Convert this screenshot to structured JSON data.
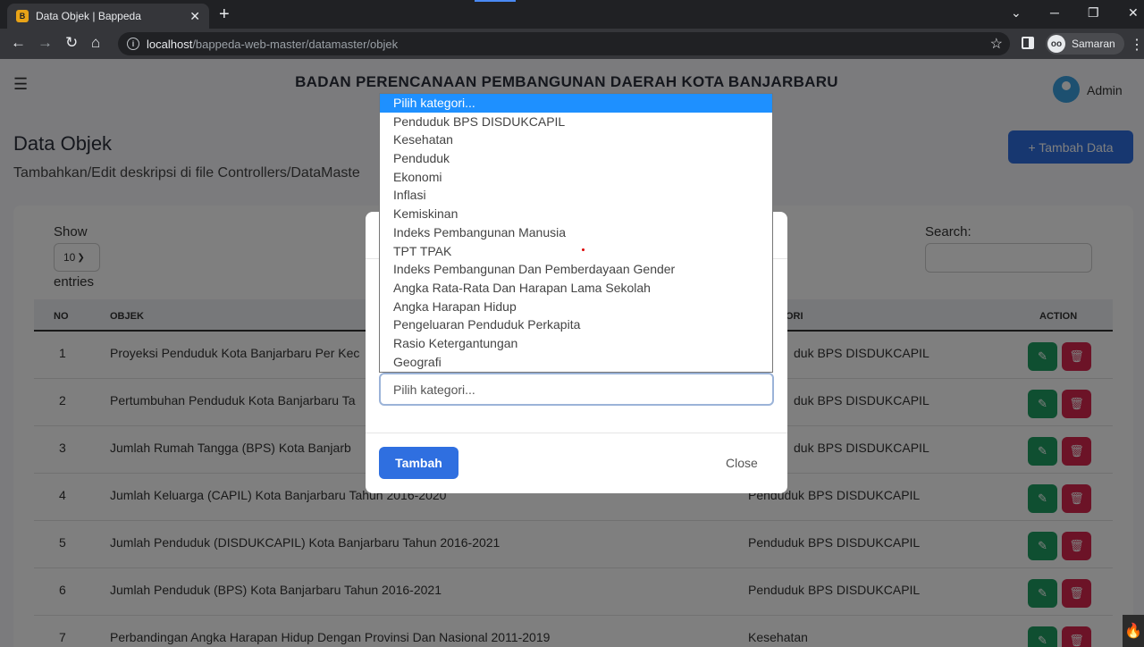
{
  "browser": {
    "tab_title": "Data Objek | Bappeda",
    "tab_close": "✕",
    "new_tab": "+",
    "url_host": "localhost",
    "url_path": "/bappeda-web-master/datamaster/objek",
    "profile_name": "Samaran",
    "controls": {
      "chevron": "⌄",
      "minimize": "─",
      "restore": "❐",
      "close": "✕"
    },
    "nav": {
      "back": "←",
      "forward": "→",
      "reload": "↻",
      "home": "⌂"
    },
    "star": "☆",
    "menu": "⋮"
  },
  "header": {
    "title": "BADAN PERENCANAAN PEMBANGUNAN DAERAH KOTA BANJARBARU",
    "user": "Admin",
    "menu_icon": "☰"
  },
  "page": {
    "heading": "Data Objek",
    "subtitle": "Tambahkan/Edit deskripsi di file Controllers/DataMaste",
    "add_button": "+ Tambah Data"
  },
  "table": {
    "show_label": "Show",
    "length_value": "10",
    "entries_label": "entries",
    "search_label": "Search:",
    "headers": {
      "no": "NO",
      "objek": "OBJEK",
      "kategori": "ORI",
      "action": "ACTION"
    },
    "rows": [
      {
        "no": "1",
        "objek": "Proyeksi Penduduk Kota Banjarbaru Per Kec",
        "kategori": "duk BPS DISDUKCAPIL"
      },
      {
        "no": "2",
        "objek": "Pertumbuhan Penduduk Kota Banjarbaru Ta",
        "kategori": "duk BPS DISDUKCAPIL"
      },
      {
        "no": "3",
        "objek": "Jumlah Rumah Tangga (BPS) Kota Banjarb",
        "kategori": "duk BPS DISDUKCAPIL"
      },
      {
        "no": "4",
        "objek": "Jumlah Keluarga (CAPIL) Kota Banjarbaru Tahun 2016-2020",
        "kategori": "Penduduk BPS DISDUKCAPIL"
      },
      {
        "no": "5",
        "objek": "Jumlah Penduduk (DISDUKCAPIL) Kota Banjarbaru Tahun 2016-2021",
        "kategori": "Penduduk BPS DISDUKCAPIL"
      },
      {
        "no": "6",
        "objek": "Jumlah Penduduk (BPS) Kota Banjarbaru Tahun 2016-2021",
        "kategori": "Penduduk BPS DISDUKCAPIL"
      },
      {
        "no": "7",
        "objek": "Perbandingan Angka Harapan Hidup Dengan Provinsi Dan Nasional 2011-2019",
        "kategori": "Kesehatan"
      }
    ]
  },
  "modal": {
    "select_value": "Pilih kategori...",
    "submit": "Tambah",
    "close": "Close",
    "options": [
      "Pilih kategori...",
      "Penduduk BPS DISDUKCAPIL",
      "Kesehatan",
      "Penduduk",
      "Ekonomi",
      "Inflasi",
      "Kemiskinan",
      "Indeks Pembangunan Manusia",
      "TPT TPAK",
      "Indeks Pembangunan Dan Pemberdayaan Gender",
      "Angka Rata-Rata Dan Harapan Lama Sekolah",
      "Angka Harapan Hidup",
      "Pengeluaran Penduduk Perkapita",
      "Rasio Ketergantungan",
      "Geografi"
    ]
  },
  "colors": {
    "primary": "#2f6fe0",
    "edit": "#1f9e62",
    "delete": "#d8264f",
    "selected_option": "#1e90ff"
  }
}
